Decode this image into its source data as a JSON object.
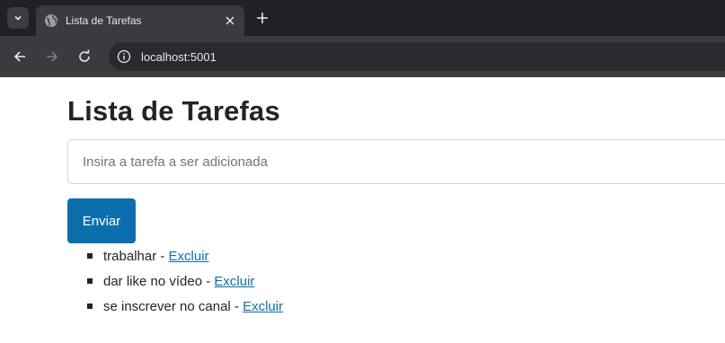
{
  "browser": {
    "tab_title": "Lista de Tarefas",
    "url": "localhost:5001"
  },
  "page": {
    "heading": "Lista de Tarefas",
    "input_placeholder": "Insira a tarefa a ser adicionada",
    "input_value": "",
    "submit_label": "Enviar",
    "separator": "-",
    "tasks": [
      {
        "text": "trabalhar",
        "delete_label": "Excluir"
      },
      {
        "text": "dar like no vídeo",
        "delete_label": "Excluir"
      },
      {
        "text": "se inscrever no canal",
        "delete_label": "Excluir"
      }
    ]
  },
  "colors": {
    "primary": "#0d6ead",
    "text": "#212529",
    "chrome_dark": "#202124",
    "chrome_toolbar": "#3a3b3e"
  }
}
